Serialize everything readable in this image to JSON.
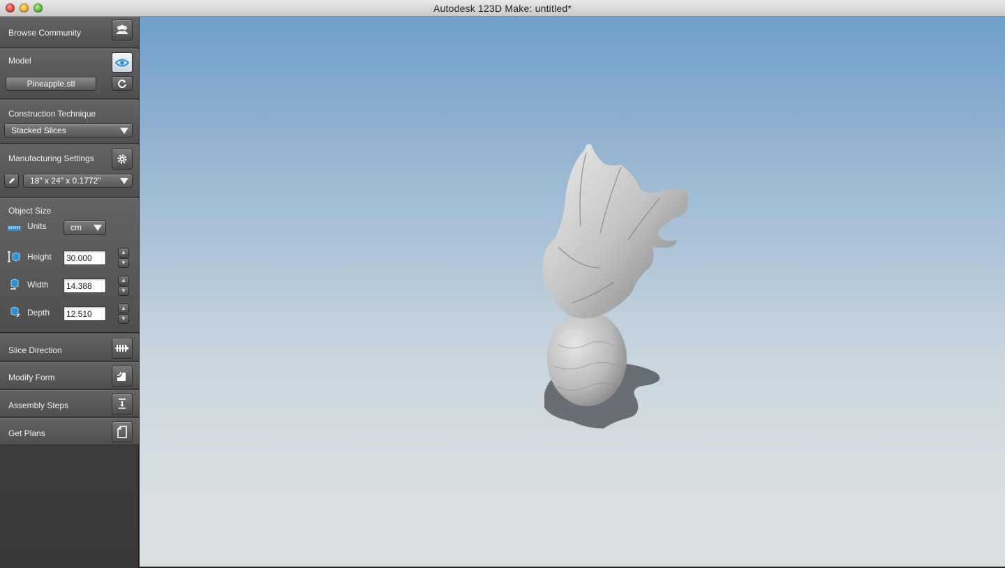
{
  "window": {
    "title": "Autodesk 123D Make: untitled*"
  },
  "sidebar": {
    "browse_community": {
      "label": "Browse Community",
      "icon": "people-icon"
    },
    "model": {
      "title": "Model",
      "file_button": "Pineapple.stl",
      "view_icon": "eye-icon",
      "reload_icon": "refresh-icon"
    },
    "construction": {
      "title": "Construction Technique",
      "selected": "Stacked Slices"
    },
    "manufacturing": {
      "title": "Manufacturing Settings",
      "selected": "18\" x 24\" x 0.1772\"",
      "settings_icon": "gear-icon",
      "edit_icon": "pencil-icon"
    },
    "object_size": {
      "title": "Object Size",
      "units_label": "Units",
      "units_value": "cm",
      "height_label": "Height",
      "height_value": "30.000",
      "width_label": "Width",
      "width_value": "14.388",
      "depth_label": "Depth",
      "depth_value": "12.510"
    },
    "slice_direction": {
      "label": "Slice Direction",
      "icon": "slice-direction-icon"
    },
    "modify_form": {
      "label": "Modify Form",
      "icon": "modify-form-icon"
    },
    "assembly_steps": {
      "label": "Assembly Steps",
      "icon": "assembly-steps-icon"
    },
    "get_plans": {
      "label": "Get Plans",
      "icon": "document-icon"
    }
  },
  "colors": {
    "accent": "#2d8fd4",
    "viewport_top": "#709fc9",
    "viewport_bottom": "#dadfe2"
  }
}
